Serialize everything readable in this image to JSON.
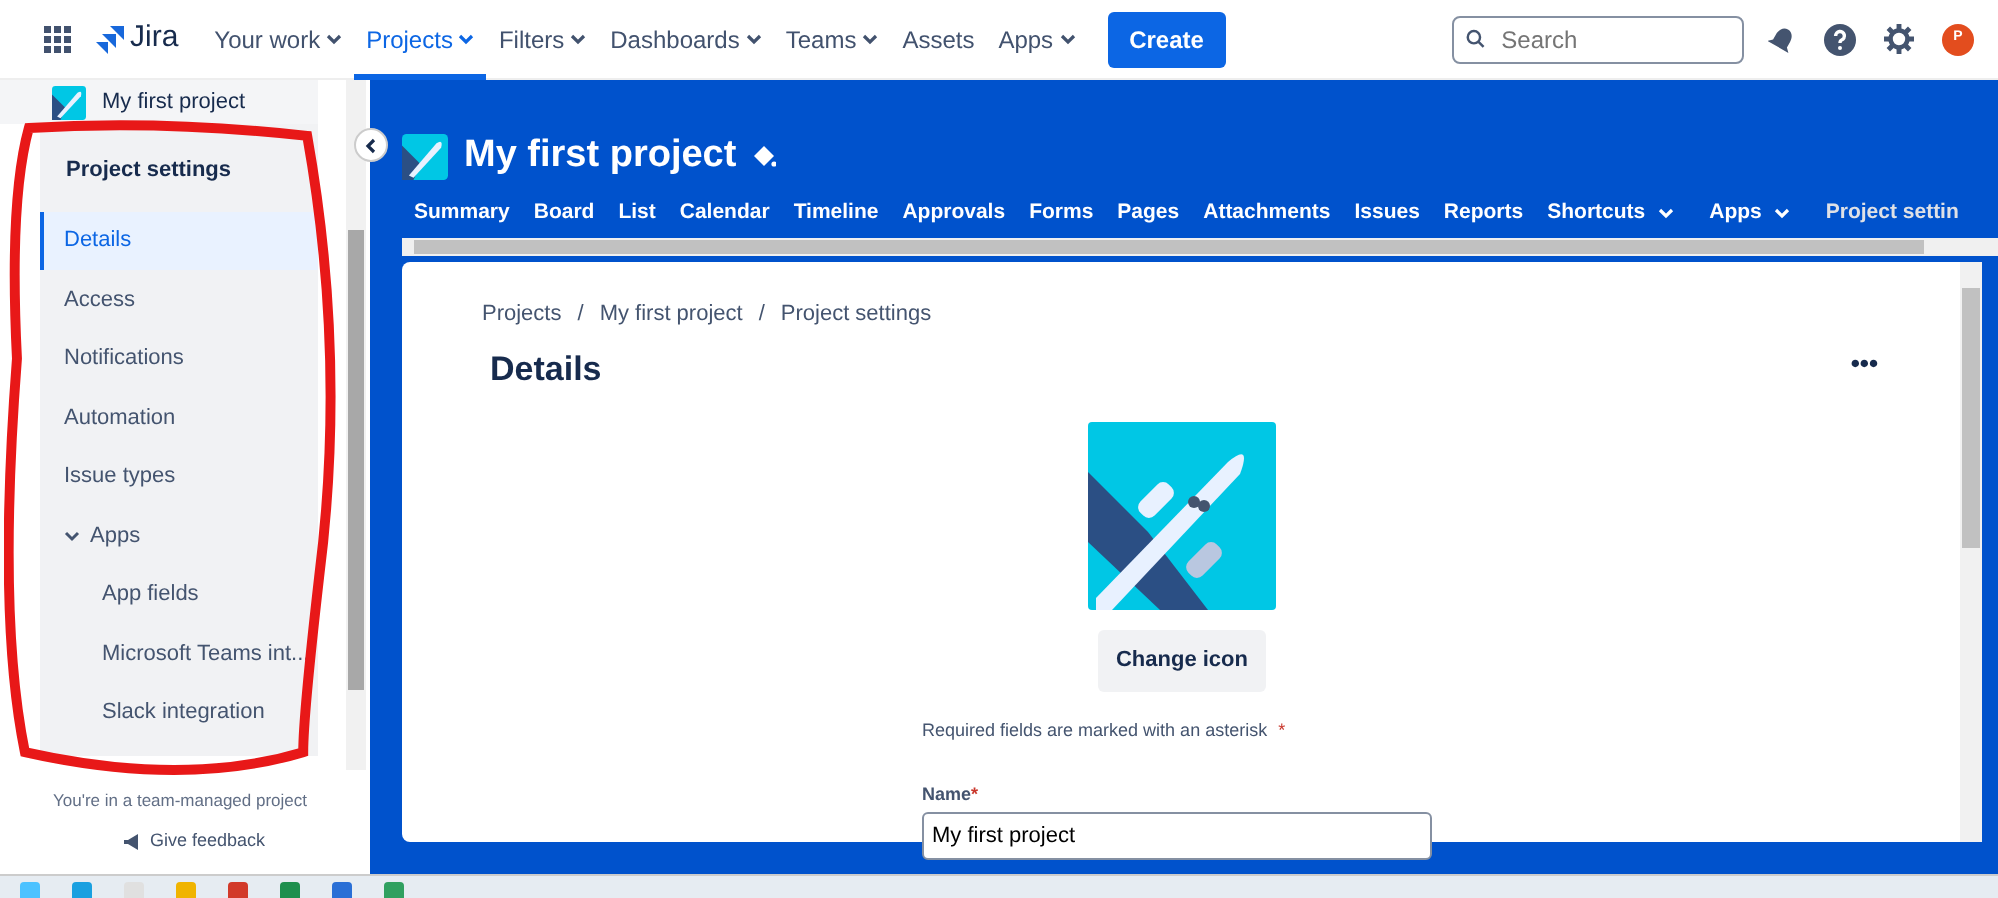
{
  "topnav": {
    "logo": "Jira",
    "items": [
      {
        "label": "Your work",
        "dropdown": true,
        "selected": false
      },
      {
        "label": "Projects",
        "dropdown": true,
        "selected": true
      },
      {
        "label": "Filters",
        "dropdown": true,
        "selected": false
      },
      {
        "label": "Dashboards",
        "dropdown": true,
        "selected": false
      },
      {
        "label": "Teams",
        "dropdown": true,
        "selected": false
      },
      {
        "label": "Assets",
        "dropdown": false,
        "selected": false
      },
      {
        "label": "Apps",
        "dropdown": true,
        "selected": false
      }
    ],
    "create": "Create",
    "search": {
      "placeholder": "Search"
    },
    "avatar": "P"
  },
  "sidebar": {
    "project": "My first project",
    "heading": "Project settings",
    "items": [
      {
        "label": "Details",
        "selected": true
      },
      {
        "label": "Access",
        "selected": false
      },
      {
        "label": "Notifications",
        "selected": false
      },
      {
        "label": "Automation",
        "selected": false
      },
      {
        "label": "Issue types",
        "selected": false
      },
      {
        "label": "Apps",
        "selected": false,
        "expanded": true,
        "children": [
          {
            "label": "App fields",
            "selected": false
          },
          {
            "label": "Microsoft Teams int...",
            "selected": false
          },
          {
            "label": "Slack integration",
            "selected": false
          }
        ]
      }
    ],
    "note": "You're in a team-managed project",
    "feedback": "Give feedback"
  },
  "project": {
    "title": "My first project",
    "tabs": [
      {
        "label": "Summary",
        "dropdown": false,
        "selected": false
      },
      {
        "label": "Board",
        "dropdown": false,
        "selected": false
      },
      {
        "label": "List",
        "dropdown": false,
        "selected": false
      },
      {
        "label": "Calendar",
        "dropdown": false,
        "selected": false
      },
      {
        "label": "Timeline",
        "dropdown": false,
        "selected": false
      },
      {
        "label": "Approvals",
        "dropdown": false,
        "selected": false
      },
      {
        "label": "Forms",
        "dropdown": false,
        "selected": false
      },
      {
        "label": "Pages",
        "dropdown": false,
        "selected": false
      },
      {
        "label": "Attachments",
        "dropdown": false,
        "selected": false
      },
      {
        "label": "Issues",
        "dropdown": false,
        "selected": false
      },
      {
        "label": "Reports",
        "dropdown": false,
        "selected": false
      },
      {
        "label": "Shortcuts",
        "dropdown": true,
        "selected": false
      },
      {
        "label": "Apps",
        "dropdown": true,
        "selected": false
      },
      {
        "label": "Project settin",
        "dropdown": false,
        "selected": true
      }
    ]
  },
  "content": {
    "breadcrumbs": [
      "Projects",
      "My first project",
      "Project settings"
    ],
    "breadcrumb_separators": [
      "/",
      "/"
    ],
    "title": "Details",
    "more": "•••",
    "change_icon": "Change icon",
    "required_note": "Required fields are marked with an asterisk",
    "required_mark": "*",
    "field": {
      "label": "Name",
      "required_mark": "*",
      "value": "My first project"
    }
  }
}
